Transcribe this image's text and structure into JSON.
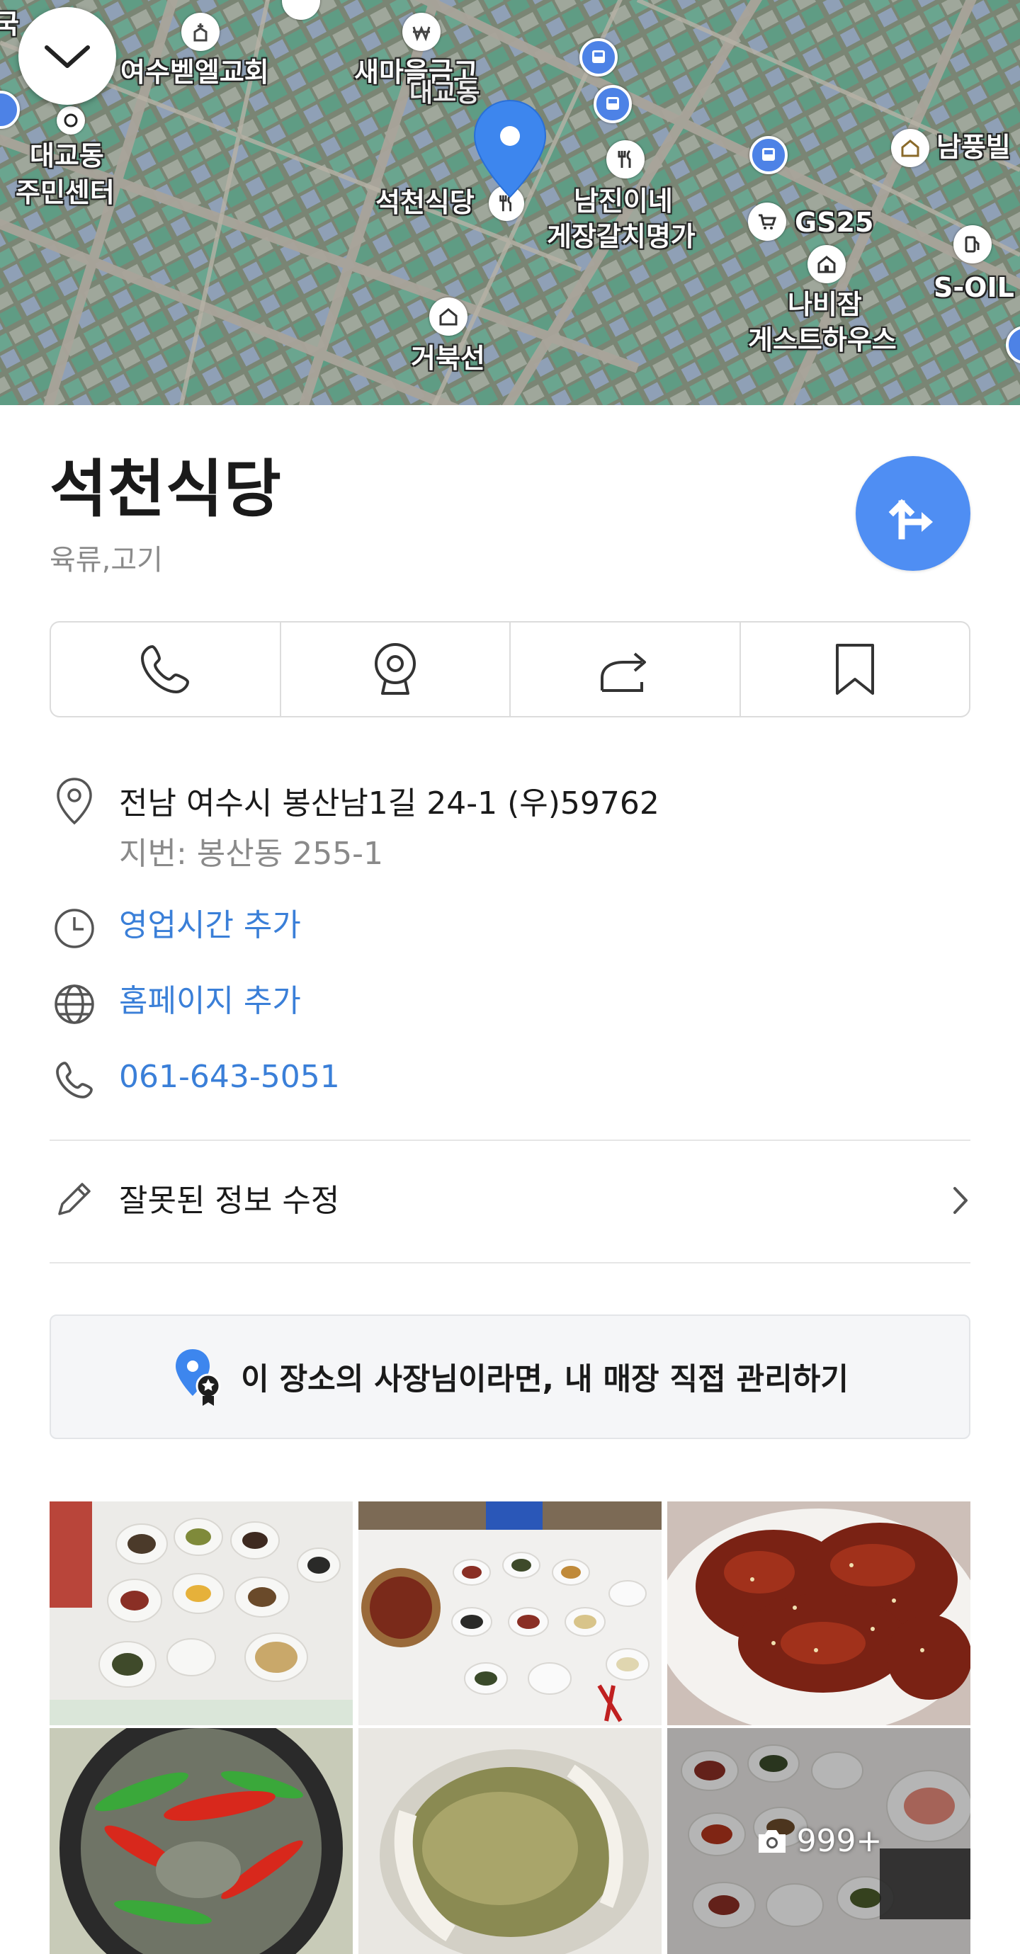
{
  "map": {
    "labels": [
      {
        "id": "church",
        "text": "여수벧엘교회"
      },
      {
        "id": "bank",
        "text": "새마을금고"
      },
      {
        "id": "district",
        "text": "대교동"
      },
      {
        "id": "center1",
        "text": "대교동"
      },
      {
        "id": "center2",
        "text": "주민센터"
      },
      {
        "id": "place",
        "text": "석천식당"
      },
      {
        "id": "rest1",
        "text": "남진이네"
      },
      {
        "id": "rest2",
        "text": "게장갈치명가"
      },
      {
        "id": "gs",
        "text": "GS25"
      },
      {
        "id": "guest1",
        "text": "나비잠"
      },
      {
        "id": "guest2",
        "text": "게스트하우스"
      },
      {
        "id": "soil",
        "text": "S-OIL"
      },
      {
        "id": "turtle",
        "text": "거북선"
      },
      {
        "id": "nampung",
        "text": "남풍빌"
      },
      {
        "id": "edge",
        "text": "국"
      }
    ]
  },
  "place": {
    "name": "석천식당",
    "category": "육류,고기"
  },
  "actions": {
    "call": "phone-icon",
    "streetview": "roadview-icon",
    "share": "share-icon",
    "save": "bookmark-icon"
  },
  "info": {
    "address": "전남 여수시 봉산남1길 24-1 (우)59762",
    "jibun": "지번: 봉산동 255-1",
    "hours_link": "영업시간 추가",
    "homepage_link": "홈페이지 추가",
    "phone": "061-643-5051"
  },
  "edit": {
    "label": "잘못된 정보 수정"
  },
  "owner_banner": {
    "text": "이 장소의 사장님이라면, 내 매장 직접 관리하기"
  },
  "photos": {
    "count_label": "999+"
  },
  "colors": {
    "accent_blue": "#4f8ef3",
    "link_blue": "#3a7fd8",
    "muted_gray": "#8a8a8a"
  }
}
